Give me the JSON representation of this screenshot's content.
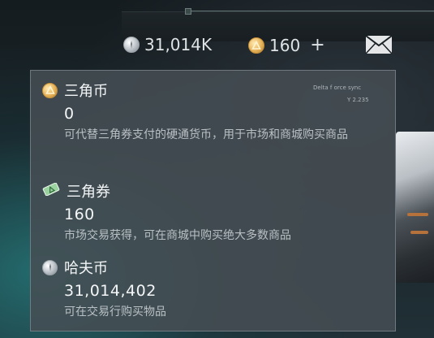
{
  "topbar": {
    "hafu_amount": "31,014K",
    "sanjiao_amount": "160",
    "add_symbol": "+",
    "mail_icon": "mail-icon"
  },
  "hud": {
    "label": "Delta f orce sync",
    "code": "Y  2.235"
  },
  "tooltip": {
    "entries": [
      {
        "icon": "triangle-coin-icon",
        "title": "三角币",
        "value": "0",
        "desc": "可代替三角券支付的硬通货币，用于市场和商城购买商品"
      },
      {
        "icon": "triangle-ticket-icon",
        "title": "三角券",
        "value": "160",
        "desc": "市场交易获得，可在商城中购买绝大多数商品"
      },
      {
        "icon": "hafu-coin-icon",
        "title": "哈夫币",
        "value": "31,014,402",
        "desc": "可在交易行购买物品"
      }
    ]
  },
  "colors": {
    "gold": "#e6b35a",
    "silver": "#b9c0c6",
    "ticket_green": "#9bd2a0"
  }
}
